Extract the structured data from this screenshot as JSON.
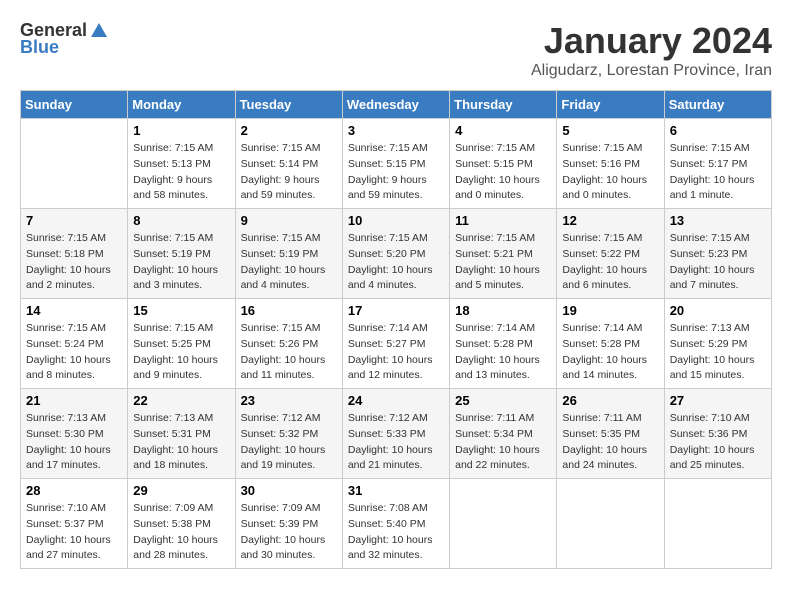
{
  "logo": {
    "general": "General",
    "blue": "Blue"
  },
  "title": "January 2024",
  "subtitle": "Aligudarz, Lorestan Province, Iran",
  "days_of_week": [
    "Sunday",
    "Monday",
    "Tuesday",
    "Wednesday",
    "Thursday",
    "Friday",
    "Saturday"
  ],
  "weeks": [
    [
      {
        "day": "",
        "info": ""
      },
      {
        "day": "1",
        "info": "Sunrise: 7:15 AM\nSunset: 5:13 PM\nDaylight: 9 hours\nand 58 minutes."
      },
      {
        "day": "2",
        "info": "Sunrise: 7:15 AM\nSunset: 5:14 PM\nDaylight: 9 hours\nand 59 minutes."
      },
      {
        "day": "3",
        "info": "Sunrise: 7:15 AM\nSunset: 5:15 PM\nDaylight: 9 hours\nand 59 minutes."
      },
      {
        "day": "4",
        "info": "Sunrise: 7:15 AM\nSunset: 5:15 PM\nDaylight: 10 hours\nand 0 minutes."
      },
      {
        "day": "5",
        "info": "Sunrise: 7:15 AM\nSunset: 5:16 PM\nDaylight: 10 hours\nand 0 minutes."
      },
      {
        "day": "6",
        "info": "Sunrise: 7:15 AM\nSunset: 5:17 PM\nDaylight: 10 hours\nand 1 minute."
      }
    ],
    [
      {
        "day": "7",
        "info": "Sunrise: 7:15 AM\nSunset: 5:18 PM\nDaylight: 10 hours\nand 2 minutes."
      },
      {
        "day": "8",
        "info": "Sunrise: 7:15 AM\nSunset: 5:19 PM\nDaylight: 10 hours\nand 3 minutes."
      },
      {
        "day": "9",
        "info": "Sunrise: 7:15 AM\nSunset: 5:19 PM\nDaylight: 10 hours\nand 4 minutes."
      },
      {
        "day": "10",
        "info": "Sunrise: 7:15 AM\nSunset: 5:20 PM\nDaylight: 10 hours\nand 4 minutes."
      },
      {
        "day": "11",
        "info": "Sunrise: 7:15 AM\nSunset: 5:21 PM\nDaylight: 10 hours\nand 5 minutes."
      },
      {
        "day": "12",
        "info": "Sunrise: 7:15 AM\nSunset: 5:22 PM\nDaylight: 10 hours\nand 6 minutes."
      },
      {
        "day": "13",
        "info": "Sunrise: 7:15 AM\nSunset: 5:23 PM\nDaylight: 10 hours\nand 7 minutes."
      }
    ],
    [
      {
        "day": "14",
        "info": "Sunrise: 7:15 AM\nSunset: 5:24 PM\nDaylight: 10 hours\nand 8 minutes."
      },
      {
        "day": "15",
        "info": "Sunrise: 7:15 AM\nSunset: 5:25 PM\nDaylight: 10 hours\nand 9 minutes."
      },
      {
        "day": "16",
        "info": "Sunrise: 7:15 AM\nSunset: 5:26 PM\nDaylight: 10 hours\nand 11 minutes."
      },
      {
        "day": "17",
        "info": "Sunrise: 7:14 AM\nSunset: 5:27 PM\nDaylight: 10 hours\nand 12 minutes."
      },
      {
        "day": "18",
        "info": "Sunrise: 7:14 AM\nSunset: 5:28 PM\nDaylight: 10 hours\nand 13 minutes."
      },
      {
        "day": "19",
        "info": "Sunrise: 7:14 AM\nSunset: 5:28 PM\nDaylight: 10 hours\nand 14 minutes."
      },
      {
        "day": "20",
        "info": "Sunrise: 7:13 AM\nSunset: 5:29 PM\nDaylight: 10 hours\nand 15 minutes."
      }
    ],
    [
      {
        "day": "21",
        "info": "Sunrise: 7:13 AM\nSunset: 5:30 PM\nDaylight: 10 hours\nand 17 minutes."
      },
      {
        "day": "22",
        "info": "Sunrise: 7:13 AM\nSunset: 5:31 PM\nDaylight: 10 hours\nand 18 minutes."
      },
      {
        "day": "23",
        "info": "Sunrise: 7:12 AM\nSunset: 5:32 PM\nDaylight: 10 hours\nand 19 minutes."
      },
      {
        "day": "24",
        "info": "Sunrise: 7:12 AM\nSunset: 5:33 PM\nDaylight: 10 hours\nand 21 minutes."
      },
      {
        "day": "25",
        "info": "Sunrise: 7:11 AM\nSunset: 5:34 PM\nDaylight: 10 hours\nand 22 minutes."
      },
      {
        "day": "26",
        "info": "Sunrise: 7:11 AM\nSunset: 5:35 PM\nDaylight: 10 hours\nand 24 minutes."
      },
      {
        "day": "27",
        "info": "Sunrise: 7:10 AM\nSunset: 5:36 PM\nDaylight: 10 hours\nand 25 minutes."
      }
    ],
    [
      {
        "day": "28",
        "info": "Sunrise: 7:10 AM\nSunset: 5:37 PM\nDaylight: 10 hours\nand 27 minutes."
      },
      {
        "day": "29",
        "info": "Sunrise: 7:09 AM\nSunset: 5:38 PM\nDaylight: 10 hours\nand 28 minutes."
      },
      {
        "day": "30",
        "info": "Sunrise: 7:09 AM\nSunset: 5:39 PM\nDaylight: 10 hours\nand 30 minutes."
      },
      {
        "day": "31",
        "info": "Sunrise: 7:08 AM\nSunset: 5:40 PM\nDaylight: 10 hours\nand 32 minutes."
      },
      {
        "day": "",
        "info": ""
      },
      {
        "day": "",
        "info": ""
      },
      {
        "day": "",
        "info": ""
      }
    ]
  ]
}
